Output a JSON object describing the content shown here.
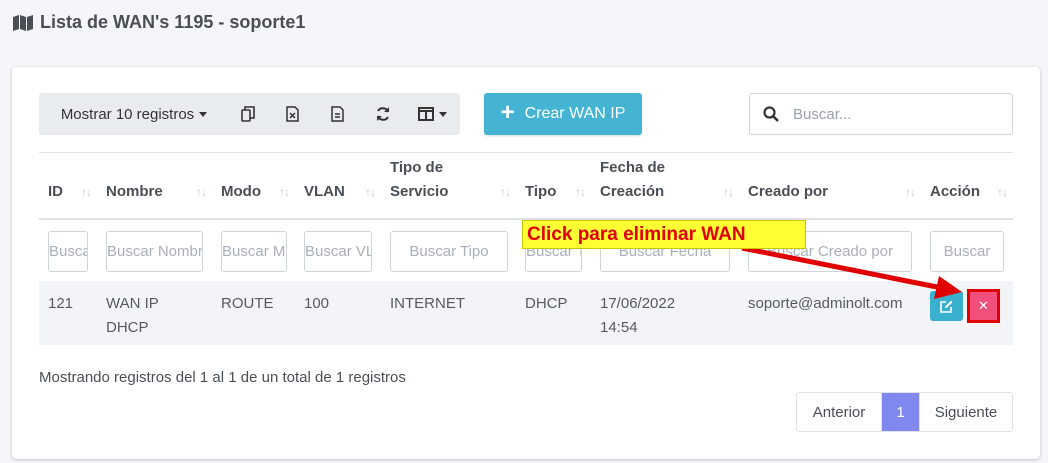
{
  "header": {
    "title": "Lista de WAN's 1195 - soporte1",
    "icon": "map-icon"
  },
  "toolbar": {
    "show_label": "Mostrar 10 registros",
    "copy_icon": "copy-icon",
    "excel_icon": "excel-icon",
    "pdf_icon": "document-icon",
    "refresh_icon": "refresh-icon",
    "columns_icon": "columns-icon",
    "create_label": "Crear WAN IP"
  },
  "search": {
    "placeholder": "Buscar..."
  },
  "table": {
    "headers": {
      "id": "ID",
      "nombre": "Nombre",
      "modo": "Modo",
      "vlan": "VLAN",
      "tipo_servicio_1": "Tipo de",
      "tipo_servicio_2": "Servicio",
      "tipo": "Tipo",
      "fecha_1": "Fecha de",
      "fecha_2": "Creación",
      "creado": "Creado por",
      "accion": "Acción"
    },
    "sort_glyph": "↑↓",
    "filters": {
      "id": "Buscar ID",
      "nombre": "Buscar Nombre",
      "modo": "Buscar Modo",
      "vlan": "Buscar VLAN",
      "tipo_servicio": "Buscar Tipo",
      "tipo": "Buscar Tipo",
      "fecha": "Buscar Fecha",
      "creado": "Buscar Creado por",
      "accion": "Buscar"
    },
    "rows": [
      {
        "id": "121",
        "nombre_1": "WAN IP",
        "nombre_2": "DHCP",
        "modo": "ROUTE",
        "vlan": "100",
        "tipo_servicio": "INTERNET",
        "tipo": "DHCP",
        "fecha_1": "17/06/2022",
        "fecha_2": "14:54",
        "creado": "soporte@adminolt.com"
      }
    ]
  },
  "annotation": {
    "text": "Click para eliminar WAN",
    "color": "#e00000",
    "bg": "#ffff33"
  },
  "footer": {
    "info": "Mostrando registros del 1 al 1 de un total de 1 registros",
    "prev": "Anterior",
    "current": "1",
    "next": "Siguiente"
  }
}
